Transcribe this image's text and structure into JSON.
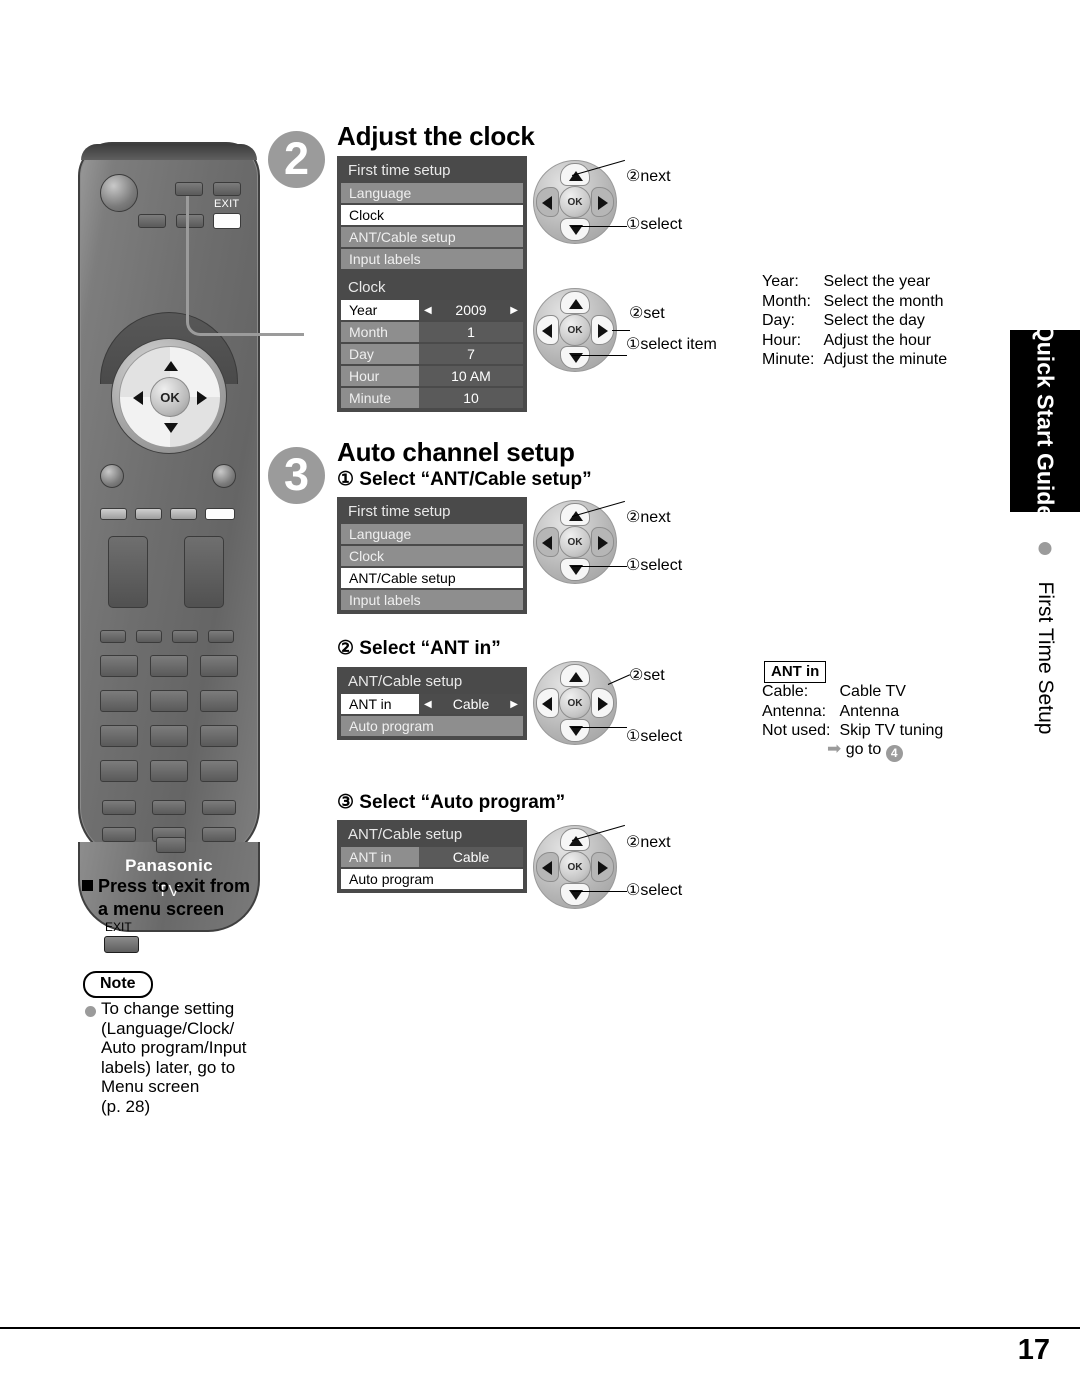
{
  "page": {
    "number": "17"
  },
  "side_tab": {
    "black_label": "Quick Start Guide",
    "sub_label": "First Time Setup"
  },
  "remote": {
    "exit_label": "EXIT",
    "brand": "Panasonic",
    "device": "TV",
    "ok_label": "OK"
  },
  "steps": [
    {
      "number": "2",
      "title": "Adjust the clock",
      "blocks": [
        {
          "menu": {
            "title": "First time setup",
            "rows": [
              {
                "label": "Language",
                "selected": false
              },
              {
                "label": "Clock",
                "selected": true
              },
              {
                "label": "ANT/Cable setup",
                "selected": false
              },
              {
                "label": "Input labels",
                "selected": false
              }
            ]
          },
          "navpad": {
            "ok_label": "OK",
            "active": [
              "up",
              "down"
            ],
            "callouts": [
              {
                "num": "②",
                "text": "next"
              },
              {
                "num": "①",
                "text": "select"
              }
            ]
          }
        },
        {
          "menu": {
            "title": "Clock",
            "rows": [
              {
                "label": "Year",
                "value": "2009",
                "selected": true,
                "arrows": true
              },
              {
                "label": "Month",
                "value": "1",
                "selected": false,
                "arrows": false
              },
              {
                "label": "Day",
                "value": "7",
                "selected": false,
                "arrows": false
              },
              {
                "label": "Hour",
                "value": "10 AM",
                "selected": false,
                "arrows": false
              },
              {
                "label": "Minute",
                "value": "10",
                "selected": false,
                "arrows": false
              }
            ]
          },
          "navpad": {
            "ok_label": "OK",
            "active": [
              "up",
              "down",
              "left",
              "right"
            ],
            "callouts": [
              {
                "num": "②",
                "text": "set"
              },
              {
                "num": "①",
                "text": "select item"
              }
            ]
          },
          "description": {
            "rows": [
              {
                "key": "Year:",
                "value": "Select the year"
              },
              {
                "key": "Month:",
                "value": "Select the month"
              },
              {
                "key": "Day:",
                "value": "Select the day"
              },
              {
                "key": "Hour:",
                "value": "Adjust the hour"
              },
              {
                "key": "Minute:",
                "value": "Adjust the minute"
              }
            ]
          }
        }
      ]
    },
    {
      "number": "3",
      "title": "Auto channel setup",
      "substeps": [
        {
          "heading": "① Select “ANT/Cable setup”",
          "menu": {
            "title": "First time setup",
            "rows": [
              {
                "label": "Language",
                "selected": false
              },
              {
                "label": "Clock",
                "selected": false
              },
              {
                "label": "ANT/Cable setup",
                "selected": true
              },
              {
                "label": "Input labels",
                "selected": false
              }
            ]
          },
          "navpad": {
            "ok_label": "OK",
            "active": [
              "up",
              "down"
            ],
            "callouts": [
              {
                "num": "②",
                "text": "next"
              },
              {
                "num": "①",
                "text": "select"
              }
            ]
          }
        },
        {
          "heading": "② Select “ANT in”",
          "menu": {
            "title": "ANT/Cable setup",
            "rows": [
              {
                "label": "ANT in",
                "value": "Cable",
                "selected": true,
                "arrows": true
              },
              {
                "label": "Auto program",
                "selected": false,
                "full": true
              }
            ]
          },
          "navpad": {
            "ok_label": "OK",
            "active": [
              "up",
              "down",
              "left",
              "right"
            ],
            "callouts": [
              {
                "num": "②",
                "text": "set"
              },
              {
                "num": "①",
                "text": "select"
              }
            ]
          },
          "description": {
            "box_title": "ANT in",
            "rows": [
              {
                "key": "Cable:",
                "value": "Cable TV"
              },
              {
                "key": "Antenna:",
                "value": "Antenna"
              },
              {
                "key": "Not used:",
                "value": "Skip TV tuning"
              }
            ],
            "goto_arrow": "➡",
            "goto_text": "go to",
            "goto_step": "4"
          }
        },
        {
          "heading": "③ Select “Auto program”",
          "menu": {
            "title": "ANT/Cable setup",
            "rows": [
              {
                "label": "ANT in",
                "value": "Cable",
                "selected": false,
                "arrows": false
              },
              {
                "label": "Auto program",
                "selected": true,
                "full": true
              }
            ]
          },
          "navpad": {
            "ok_label": "OK",
            "active": [
              "up",
              "down"
            ],
            "callouts": [
              {
                "num": "②",
                "text": "next"
              },
              {
                "num": "①",
                "text": "select"
              }
            ]
          }
        }
      ]
    }
  ],
  "exit_section": {
    "heading_line1": "Press to exit from",
    "heading_line2": "a menu screen",
    "button_label": "EXIT"
  },
  "note": {
    "label": "Note",
    "lines": [
      "To change setting",
      "(Language/Clock/",
      "Auto program/Input",
      "labels) later, go to",
      "Menu screen",
      "(p. 28)"
    ]
  },
  "colors": {
    "accent_gray": "#9b9b9b",
    "menu_bg": "#4a4a4a",
    "menu_row": "#8e8e8e",
    "menu_value": "#5a5a5a",
    "tab_black": "#000000"
  }
}
